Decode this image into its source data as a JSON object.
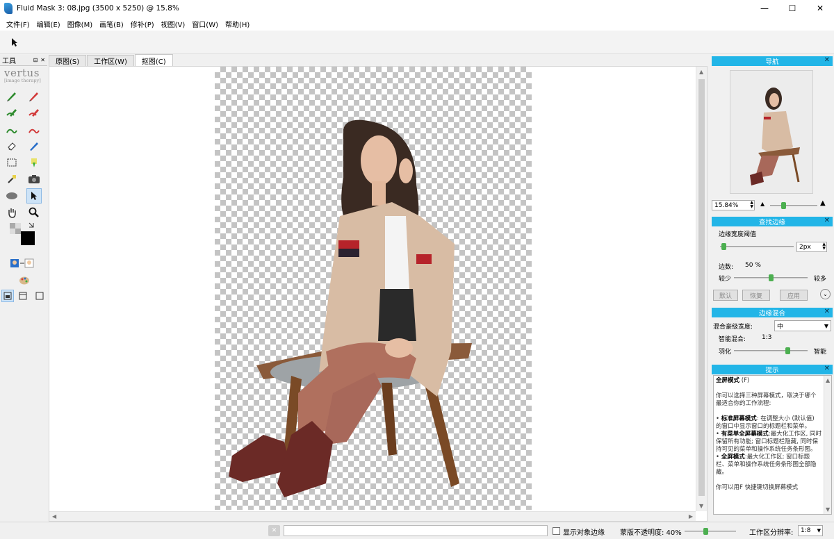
{
  "window": {
    "title": "Fluid Mask 3: 08.jpg (3500 x 5250) @ 15.8%",
    "controls": [
      "—",
      "☐",
      "✕"
    ]
  },
  "menu": [
    "文件(F)",
    "编辑(E)",
    "图像(M)",
    "画笔(B)",
    "修补(P)",
    "视图(V)",
    "窗口(W)",
    "帮助(H)"
  ],
  "toolbar": {
    "pointer_icon": "pointer-arrow-icon"
  },
  "tools_panel": {
    "title": "工具",
    "pin": "⊟",
    "close": "✕",
    "logo": "vertus",
    "logo_sub": "[image therapy]"
  },
  "tabs": [
    {
      "label": "原图(S)",
      "active": false
    },
    {
      "label": "工作区(W)",
      "active": false
    },
    {
      "label": "抠图(C)",
      "active": true
    }
  ],
  "navigator": {
    "title": "导航",
    "zoom": "15.84%"
  },
  "find_edges": {
    "title": "查找边缘",
    "threshold_label": "边缘宽度阈值",
    "threshold_value": "2px",
    "threshold_level": 0.02,
    "edge_label": "边数:",
    "edge_value": "50 %",
    "edge_level": 0.5,
    "less": "较少",
    "more": "较多",
    "btn_default": "默认",
    "btn_restore": "恢复",
    "btn_apply": "应用"
  },
  "edge_blend": {
    "title": "边缘混合",
    "width_label": "混合豪级宽度:",
    "width_value": "中",
    "smart_label": "智能混合:",
    "smart_value": "1:3",
    "feather_label": "羽化",
    "feather_right": "智能",
    "feather_level": 0.75
  },
  "hints": {
    "title": "提示",
    "heading": "全屏模式",
    "heading_key": "(F)",
    "p1": "你可以选择三种屏幕模式，取决于哪个最适合你的工作流程:",
    "b1": "标准屏幕模式",
    "t1": ": 在调整大小 (默认值) 的窗口中显示窗口的标题栏和菜单。",
    "b2": "有菜单全屏幕模式",
    "t2": ":最大化工作区, 同时保留所有功能; 窗口标题栏隐藏, 同时保持可见的菜单和操作系统任务条形图。",
    "b3": "全屏模式",
    "t3": ":最大化工作区; 窗口标题栏、菜单和操作系统任务条形图全部隐藏。",
    "p2": "你可以用F 快捷键切换屏幕模式"
  },
  "status": {
    "show_edges": "显示对象边缘",
    "mask_opacity": "蒙版不透明度: 40%",
    "mask_opacity_level": 0.4,
    "resolution_label": "工作区分辨率:",
    "resolution_value": "1:8"
  }
}
